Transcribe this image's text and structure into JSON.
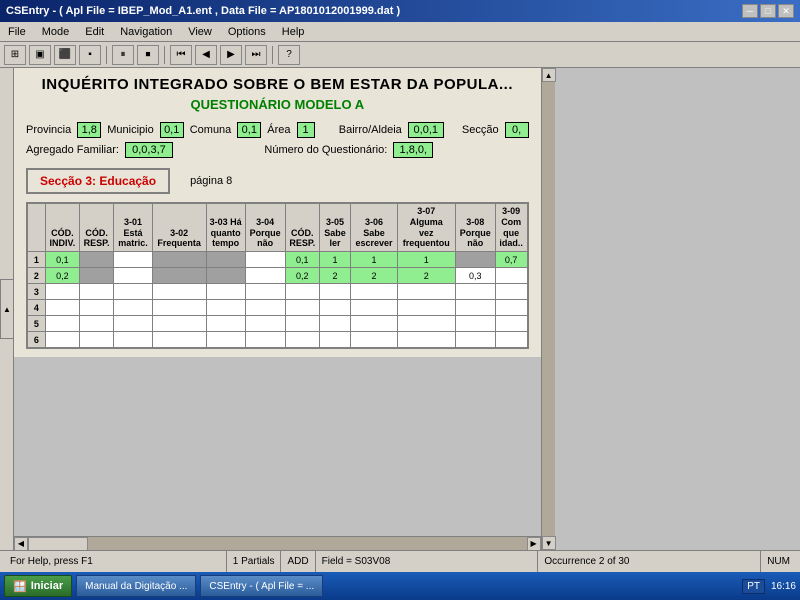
{
  "titlebar": {
    "text": "CSEntry - ( Apl File = IBEP_Mod_A1.ent , Data File = AP1801012001999.dat )",
    "min": "─",
    "max": "□",
    "close": "✕"
  },
  "menu": {
    "items": [
      "File",
      "Mode",
      "Edit",
      "Navigation",
      "View",
      "Options",
      "Help"
    ]
  },
  "toolbar": {
    "buttons": [
      "□",
      "⊞",
      "⬛",
      "▣",
      "▌▐",
      "■",
      "◀◀",
      "◀",
      "▶",
      "▶▶",
      "?"
    ]
  },
  "form": {
    "title": "INQUÉRITO INTEGRADO SOBRE O BEM ESTAR DA POPULA...",
    "subtitle": "QUESTIONÁRIO MODELO A",
    "fields": {
      "provincia_label": "Provincia",
      "provincia_value": "1,8",
      "municipio_label": "Municipio",
      "municipio_value": "0,1",
      "comuna_label": "Comuna",
      "comuna_value": "0,1",
      "area_label": "Área",
      "area_value": "1",
      "bairro_label": "Bairro/Aldeia",
      "bairro_value": "0,0,1",
      "seccao_label": "Secção",
      "seccao_value": "0,",
      "agregado_label": "Agregado Familiar:",
      "agregado_value": "0,0,3,7",
      "numero_label": "Número do Questionário:",
      "numero_value": "1,8,0,"
    },
    "section": {
      "title": "Secção 3: Educação",
      "page": "página 8"
    },
    "table": {
      "columns": [
        {
          "id": "cod_indiv",
          "lines": [
            "CÓD.",
            "INDIV."
          ]
        },
        {
          "id": "cod_resp",
          "lines": [
            "CÓD.",
            "RESP."
          ]
        },
        {
          "id": "col301",
          "lines": [
            "3-01",
            "Está",
            "matric."
          ]
        },
        {
          "id": "col302",
          "lines": [
            "3-02",
            "Frequenta"
          ]
        },
        {
          "id": "col303",
          "lines": [
            "3-03 Há",
            "quanto",
            "tempo"
          ]
        },
        {
          "id": "col304",
          "lines": [
            "3-04",
            "Porque",
            "não"
          ]
        },
        {
          "id": "cod_resp2",
          "lines": [
            "CÓD.",
            "RESP."
          ]
        },
        {
          "id": "col305",
          "lines": [
            "3-05",
            "Sabe",
            "ler"
          ]
        },
        {
          "id": "col306",
          "lines": [
            "3-06",
            "Sabe",
            "escrever"
          ]
        },
        {
          "id": "col307",
          "lines": [
            "3-07",
            "Alguma",
            "vez",
            "frequentou"
          ]
        },
        {
          "id": "col308",
          "lines": [
            "3-08",
            "Porque",
            "não"
          ]
        },
        {
          "id": "col309",
          "lines": [
            "3-09",
            "Com",
            "que",
            "idad.."
          ]
        }
      ],
      "rows": [
        {
          "num": "1",
          "cells": [
            {
              "value": "0,1",
              "type": "green"
            },
            {
              "value": "",
              "type": "gray"
            },
            {
              "value": "",
              "type": "white"
            },
            {
              "value": "",
              "type": "gray"
            },
            {
              "value": "",
              "type": "gray"
            },
            {
              "value": "",
              "type": "white"
            },
            {
              "value": "0,1",
              "type": "green"
            },
            {
              "value": "1",
              "type": "green"
            },
            {
              "value": "1",
              "type": "green"
            },
            {
              "value": "1",
              "type": "green"
            },
            {
              "value": "",
              "type": "gray"
            },
            {
              "value": "0,7",
              "type": "green"
            }
          ]
        },
        {
          "num": "2",
          "cells": [
            {
              "value": "0,2",
              "type": "green"
            },
            {
              "value": "",
              "type": "gray"
            },
            {
              "value": "",
              "type": "white"
            },
            {
              "value": "",
              "type": "gray"
            },
            {
              "value": "",
              "type": "gray"
            },
            {
              "value": "",
              "type": "white"
            },
            {
              "value": "0,2",
              "type": "green"
            },
            {
              "value": "2",
              "type": "green"
            },
            {
              "value": "2",
              "type": "green"
            },
            {
              "value": "2",
              "type": "green"
            },
            {
              "value": "0,3",
              "type": "white"
            },
            {
              "value": "",
              "type": "white"
            }
          ]
        },
        {
          "num": "3",
          "cells": [
            {
              "value": "",
              "type": "white"
            },
            {
              "value": "",
              "type": "white"
            },
            {
              "value": "",
              "type": "white"
            },
            {
              "value": "",
              "type": "white"
            },
            {
              "value": "",
              "type": "white"
            },
            {
              "value": "",
              "type": "white"
            },
            {
              "value": "",
              "type": "white"
            },
            {
              "value": "",
              "type": "white"
            },
            {
              "value": "",
              "type": "white"
            },
            {
              "value": "",
              "type": "white"
            },
            {
              "value": "",
              "type": "white"
            },
            {
              "value": "",
              "type": "white"
            }
          ]
        },
        {
          "num": "4",
          "cells": [
            {
              "value": "",
              "type": "white"
            },
            {
              "value": "",
              "type": "white"
            },
            {
              "value": "",
              "type": "white"
            },
            {
              "value": "",
              "type": "white"
            },
            {
              "value": "",
              "type": "white"
            },
            {
              "value": "",
              "type": "white"
            },
            {
              "value": "",
              "type": "white"
            },
            {
              "value": "",
              "type": "white"
            },
            {
              "value": "",
              "type": "white"
            },
            {
              "value": "",
              "type": "white"
            },
            {
              "value": "",
              "type": "white"
            },
            {
              "value": "",
              "type": "white"
            }
          ]
        },
        {
          "num": "5",
          "cells": [
            {
              "value": "",
              "type": "white"
            },
            {
              "value": "",
              "type": "white"
            },
            {
              "value": "",
              "type": "white"
            },
            {
              "value": "",
              "type": "white"
            },
            {
              "value": "",
              "type": "white"
            },
            {
              "value": "",
              "type": "white"
            },
            {
              "value": "",
              "type": "white"
            },
            {
              "value": "",
              "type": "white"
            },
            {
              "value": "",
              "type": "white"
            },
            {
              "value": "",
              "type": "white"
            },
            {
              "value": "",
              "type": "white"
            },
            {
              "value": "",
              "type": "white"
            }
          ]
        },
        {
          "num": "6",
          "cells": [
            {
              "value": "",
              "type": "white"
            },
            {
              "value": "",
              "type": "white"
            },
            {
              "value": "",
              "type": "white"
            },
            {
              "value": "",
              "type": "white"
            },
            {
              "value": "",
              "type": "white"
            },
            {
              "value": "",
              "type": "white"
            },
            {
              "value": "",
              "type": "white"
            },
            {
              "value": "",
              "type": "white"
            },
            {
              "value": "",
              "type": "white"
            },
            {
              "value": "",
              "type": "white"
            },
            {
              "value": "",
              "type": "white"
            },
            {
              "value": "",
              "type": "white"
            }
          ]
        }
      ]
    }
  },
  "statusbar": {
    "help": "For Help, press F1",
    "partials": "1 Partials",
    "mode": "ADD",
    "field": "Field = S03V08",
    "occurrence": "Occurrence 2 of 30",
    "num": "NUM"
  },
  "taskbar": {
    "start_label": "Iniciar",
    "items": [
      "Manual da Digitação ...",
      "CSEntry - ( Apl File = ..."
    ],
    "lang": "PT",
    "time": "16:16"
  }
}
